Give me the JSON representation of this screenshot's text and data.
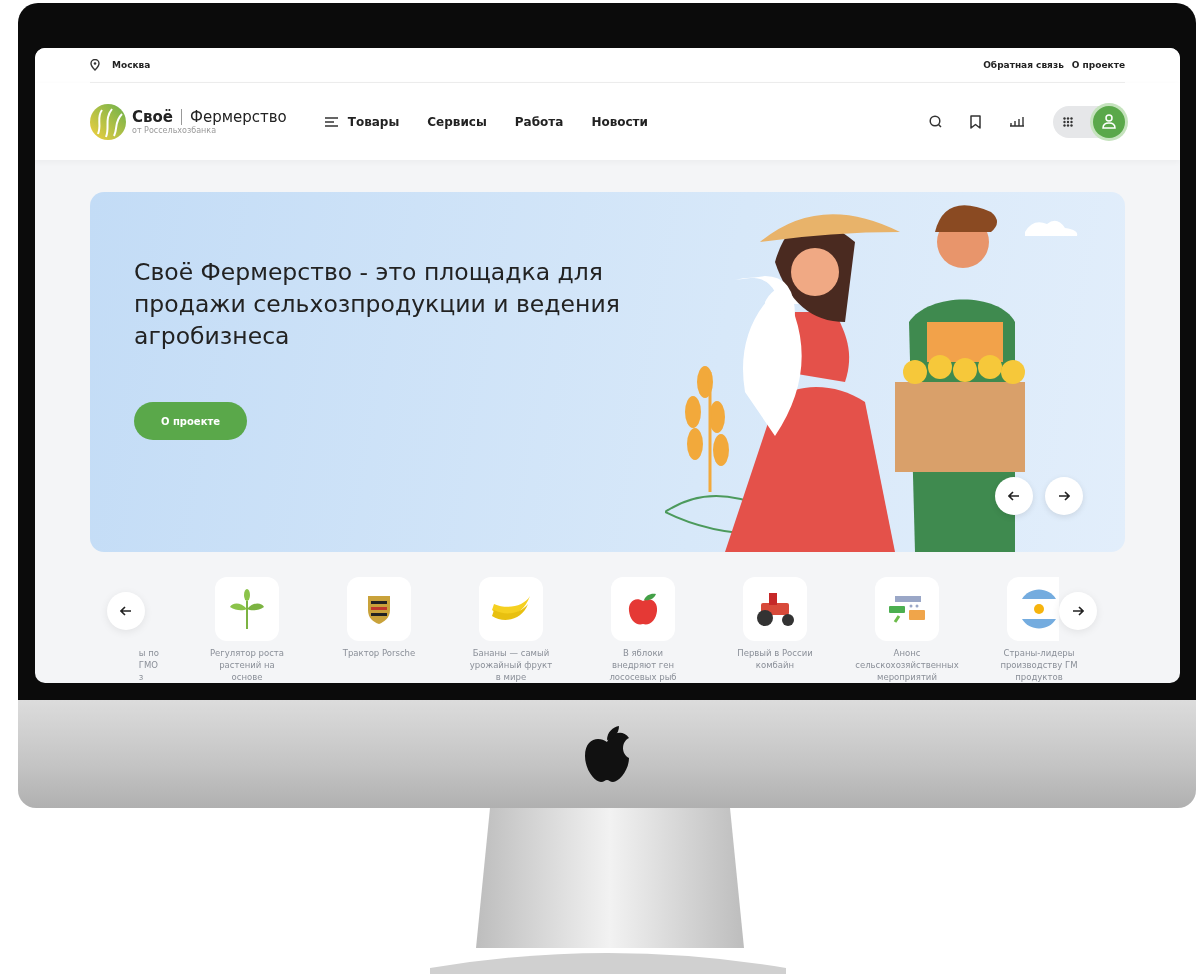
{
  "top_bar": {
    "city": "Москва",
    "links": [
      "Обратная связь",
      "О проекте"
    ]
  },
  "header": {
    "account_switch": {
      "on": true
    },
    "logo": {
      "brand": "Своё",
      "name": "Фермерство",
      "subtitle": "от Россельхозбанка"
    },
    "nav": [
      {
        "label": "Товары",
        "kind": "menu"
      },
      {
        "label": "Сервисы",
        "kind": "link"
      },
      {
        "label": "Работа",
        "kind": "link"
      },
      {
        "label": "Новости",
        "kind": "link"
      }
    ]
  },
  "hero": {
    "title": "Своё Фермерство - это площадка для продажи сельхозпродукции и ведения агробизнеса",
    "button": "О проекте"
  },
  "news": [
    {
      "caption": [
        "ы по",
        "ГМО",
        "з"
      ]
    },
    {
      "caption": [
        "Регулятор роста",
        "растений на",
        "основе"
      ]
    },
    {
      "caption": [
        "Трактор Porsche"
      ]
    },
    {
      "caption": [
        "Бананы — самый",
        "урожайный фрукт",
        "в мире"
      ]
    },
    {
      "caption": [
        "В яблоки",
        "внедряют ген",
        "лососевых рыб"
      ]
    },
    {
      "caption": [
        "Первый в России",
        "комбайн"
      ]
    },
    {
      "caption": [
        "Анонс",
        "сельскохозяйственных",
        "мероприятий"
      ]
    },
    {
      "caption": [
        "Страны-лидеры",
        "производству ГМ",
        "продуктов"
      ]
    }
  ]
}
